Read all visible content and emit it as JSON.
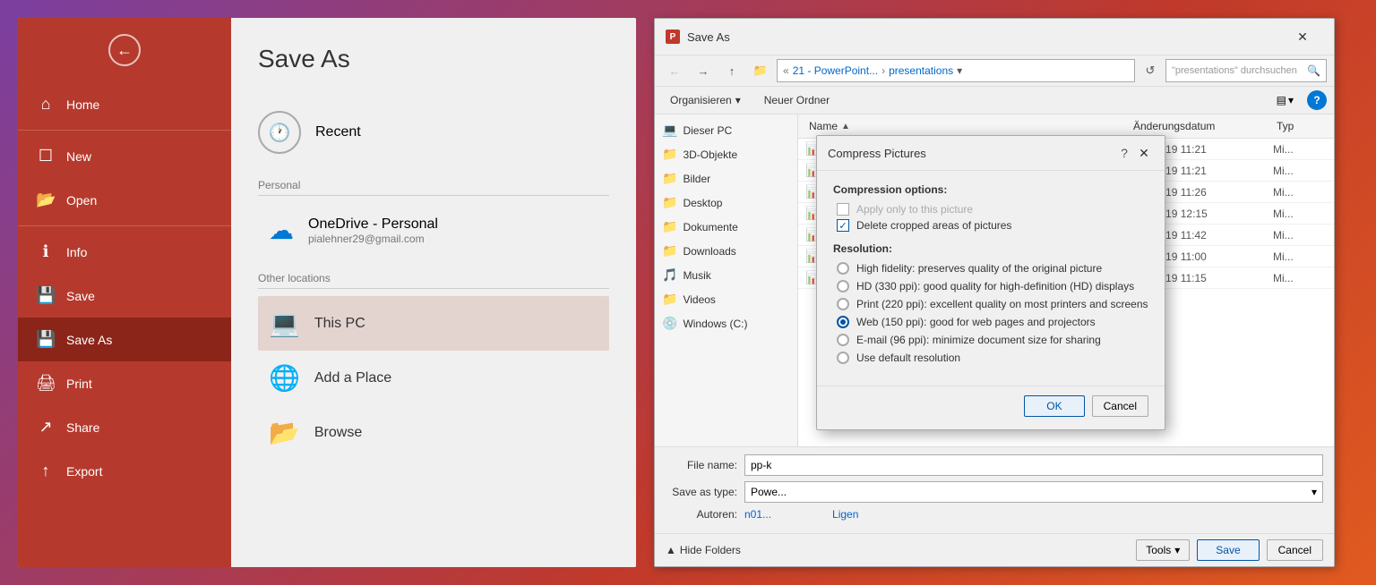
{
  "app": {
    "title": "PowerPoint Backstage"
  },
  "backstage": {
    "sidebar": {
      "back_icon": "←",
      "items": [
        {
          "id": "home",
          "label": "Home",
          "icon": "⌂",
          "active": false
        },
        {
          "id": "new",
          "label": "New",
          "icon": "☐",
          "active": false
        },
        {
          "id": "open",
          "label": "Open",
          "icon": "📁",
          "active": false
        },
        {
          "id": "info",
          "label": "Info",
          "icon": "ℹ",
          "active": false
        },
        {
          "id": "save",
          "label": "Save",
          "icon": "💾",
          "active": false
        },
        {
          "id": "save-as",
          "label": "Save As",
          "icon": "💾",
          "active": true
        },
        {
          "id": "print",
          "label": "Print",
          "icon": "🖨",
          "active": false
        },
        {
          "id": "share",
          "label": "Share",
          "icon": "↗",
          "active": false
        },
        {
          "id": "export",
          "label": "Export",
          "icon": "↑",
          "active": false
        }
      ]
    },
    "content": {
      "title": "Save As",
      "recent_label": "Recent",
      "recent_icon": "🕐",
      "section_personal": "Personal",
      "onedrive_label": "OneDrive - Personal",
      "onedrive_email": "pialehner29@gmail.com",
      "section_other": "Other locations",
      "locations": [
        {
          "id": "this-pc",
          "label": "This PC",
          "icon": "💻",
          "selected": true
        },
        {
          "id": "add-place",
          "label": "Add a Place",
          "icon": "🌐"
        },
        {
          "id": "browse",
          "label": "Browse",
          "icon": "📂"
        }
      ]
    }
  },
  "save_dialog": {
    "title": "Save As",
    "app_icon": "P",
    "close_icon": "✕",
    "nav": {
      "back_icon": "←",
      "forward_icon": "→",
      "up_icon": "↑",
      "folder_icon": "📁",
      "breadcrumb": [
        "«",
        "21 - PowerPoint...",
        ">",
        "presentations"
      ],
      "dropdown_icon": "▾",
      "refresh_icon": "↺",
      "search_placeholder": "\"presentations\" durchsuchen",
      "search_icon": "🔍"
    },
    "actions": {
      "organize_label": "Organisieren",
      "organize_dropdown": "▾",
      "new_folder_label": "Neuer Ordner",
      "view_icon": "▤",
      "view_dropdown": "▾",
      "help_label": "?"
    },
    "sidebar_folders": [
      {
        "id": "dieser-pc",
        "label": "Dieser PC",
        "icon": "💻",
        "selected": false
      },
      {
        "id": "3d-objekte",
        "label": "3D-Objekte",
        "icon": "📁"
      },
      {
        "id": "bilder",
        "label": "Bilder",
        "icon": "📁"
      },
      {
        "id": "desktop",
        "label": "Desktop",
        "icon": "📁"
      },
      {
        "id": "dokumente",
        "label": "Dokumente",
        "icon": "📁"
      },
      {
        "id": "downloads",
        "label": "Downloads",
        "icon": "📁"
      },
      {
        "id": "musik",
        "label": "Musik",
        "icon": "🎵"
      },
      {
        "id": "videos",
        "label": "Videos",
        "icon": "📁"
      },
      {
        "id": "windows-c",
        "label": "Windows (C:)",
        "icon": "💿"
      }
    ],
    "file_list": {
      "columns": {
        "name": "Name",
        "date": "Änderungsdatum",
        "type": "Typ"
      },
      "sort_arrow": "▲",
      "rows": [
        {
          "name": "...",
          "date": "8.07.2019 11:21",
          "type": "Mi..."
        },
        {
          "name": "...",
          "date": "8.07.2019 11:21",
          "type": "Mi..."
        },
        {
          "name": "...",
          "date": "8.07.2019 11:26",
          "type": "Mi..."
        },
        {
          "name": "...",
          "date": "8.07.2019 12:15",
          "type": "Mi..."
        },
        {
          "name": "...",
          "date": "2.07.2019 11:42",
          "type": "Mi..."
        },
        {
          "name": "...",
          "date": "8.07.2019 11:00",
          "type": "Mi..."
        },
        {
          "name": "...",
          "date": "1.07.2019 11:15",
          "type": "Mi..."
        }
      ]
    },
    "footer": {
      "filename_label": "File name:",
      "filename_value": "pp-k",
      "filetype_label": "Save as type:",
      "filetype_value": "Powe...",
      "filetype_dropdown": "▾",
      "authors_label": "Autoren:",
      "authors_value": "n01...",
      "tools_label": "Tools",
      "tools_dropdown": "▾",
      "save_label": "Save",
      "cancel_label": "Cancel",
      "hide_folders_label": "Hide Folders",
      "hide_folders_arrow": "▲"
    }
  },
  "compress_dialog": {
    "title": "Compress Pictures",
    "help_icon": "?",
    "close_icon": "✕",
    "compression_section": "Compression options:",
    "apply_only_label": "Apply only to this picture",
    "delete_cropped_label": "Delete cropped areas of pictures",
    "resolution_section": "Resolution:",
    "radio_options": [
      {
        "id": "high-fidelity",
        "label": "High fidelity: preserves quality of the original picture",
        "selected": false
      },
      {
        "id": "hd-330",
        "label": "HD (330 ppi): good quality for high-definition (HD) displays",
        "selected": false
      },
      {
        "id": "print-220",
        "label": "Print (220 ppi): excellent quality on most printers and screens",
        "selected": false
      },
      {
        "id": "web-150",
        "label": "Web (150 ppi): good for web pages and projectors",
        "selected": true
      },
      {
        "id": "email-96",
        "label": "E-mail (96 ppi): minimize document size for sharing",
        "selected": false
      },
      {
        "id": "default",
        "label": "Use default resolution",
        "selected": false
      }
    ],
    "ok_label": "OK",
    "cancel_label": "Cancel"
  }
}
